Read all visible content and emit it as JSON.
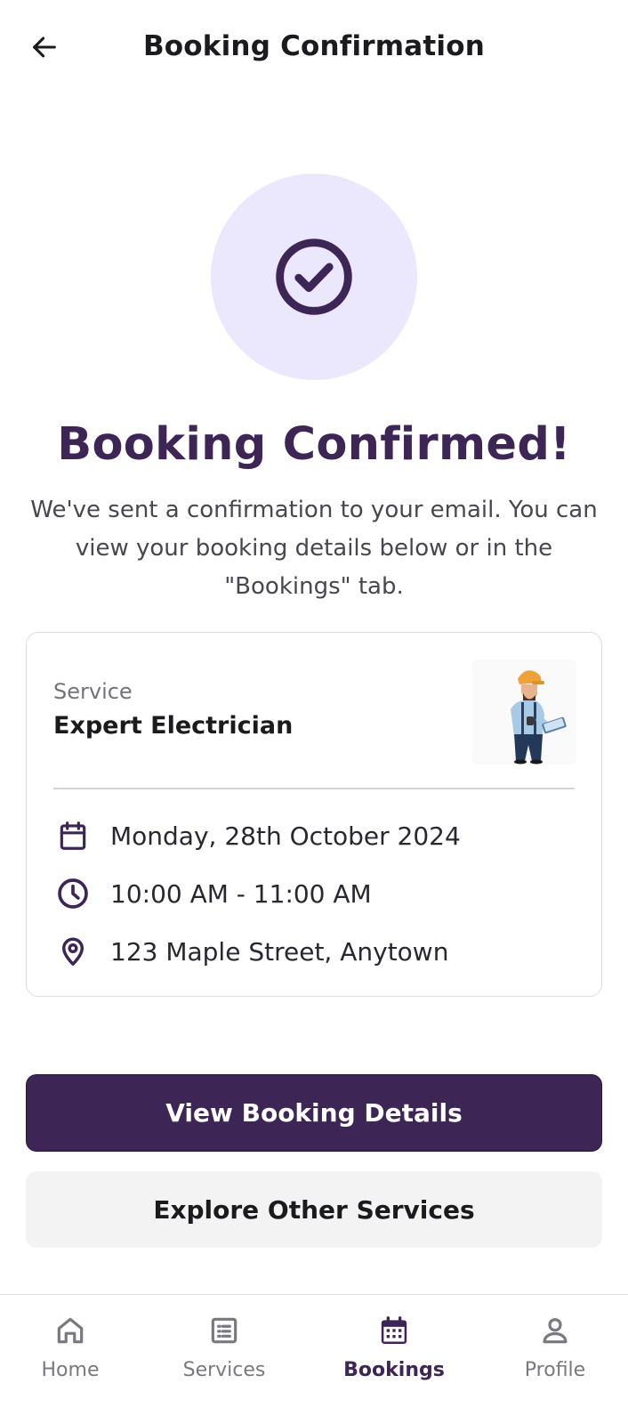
{
  "header": {
    "title": "Booking Confirmation",
    "back_icon": "arrow-left-icon"
  },
  "confirmation": {
    "icon": "check-circle-icon",
    "headline": "Booking Confirmed!",
    "message": "We've sent a confirmation to your email. You can view your booking details below or in the \"Bookings\" tab."
  },
  "booking_card": {
    "service_label": "Service",
    "service_name": "Expert Electrician",
    "image": "electrician-illustration",
    "date": "Monday, 28th October 2024",
    "time": "10:00 AM - 11:00 AM",
    "location": "123 Maple Street, Anytown"
  },
  "actions": {
    "primary_label": "View Booking Details",
    "secondary_label": "Explore Other Services"
  },
  "bottom_nav": {
    "items": [
      {
        "label": "Home",
        "icon": "home-icon",
        "active": false
      },
      {
        "label": "Services",
        "icon": "list-icon",
        "active": false
      },
      {
        "label": "Bookings",
        "icon": "calendar-icon",
        "active": true
      },
      {
        "label": "Profile",
        "icon": "person-icon",
        "active": false
      }
    ]
  },
  "colors": {
    "brand": "#3d2656",
    "accent_light": "#ebe8fd",
    "secondary_button": "#f3f3f4"
  }
}
